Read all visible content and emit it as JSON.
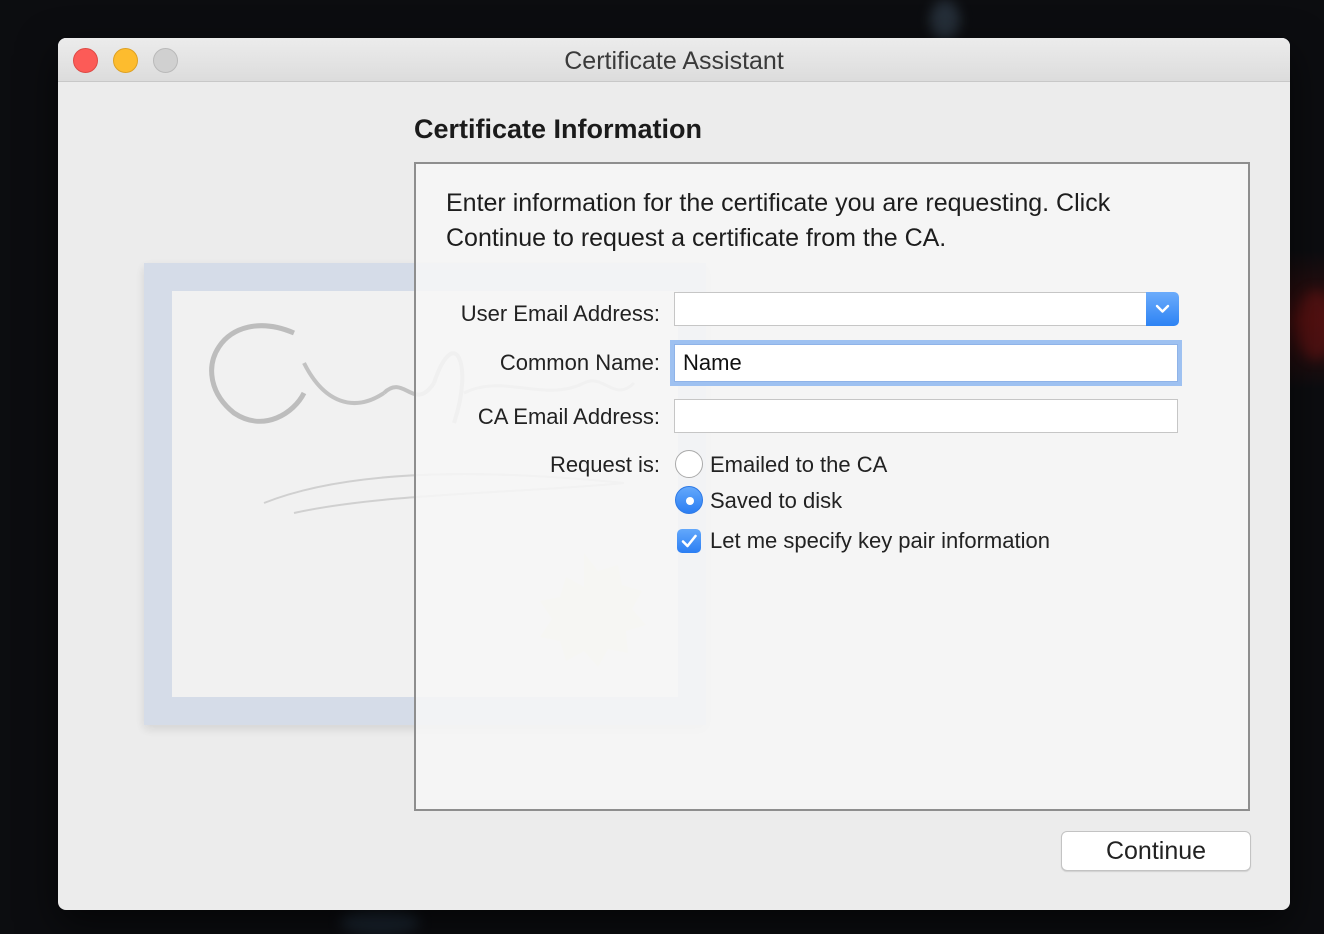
{
  "window": {
    "title": "Certificate Assistant"
  },
  "page": {
    "heading": "Certificate Information",
    "instructions": "Enter information for the certificate you are requesting. Click Continue to request a certificate from the CA."
  },
  "form": {
    "user_email_label": "User Email Address:",
    "user_email_value": "",
    "common_name_label": "Common Name:",
    "common_name_value": "Name",
    "ca_email_label": "CA Email Address:",
    "ca_email_value": "",
    "request_label": "Request is:",
    "request_options": [
      {
        "label": "Emailed to the CA",
        "selected": false
      },
      {
        "label": "Saved to disk",
        "selected": true
      }
    ],
    "key_pair_checkbox": {
      "label": "Let me specify key pair information",
      "checked": true
    }
  },
  "buttons": {
    "continue": "Continue"
  },
  "colors": {
    "accent": "#2b7ef3",
    "close": "#fc5b57",
    "minimize": "#fdbc2e"
  }
}
